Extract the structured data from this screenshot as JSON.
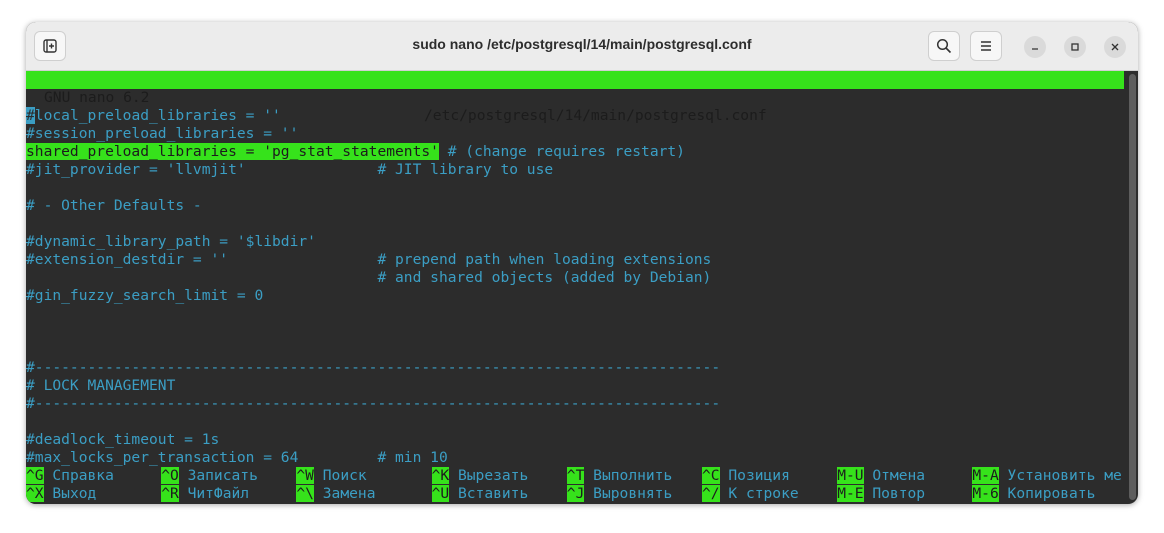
{
  "window": {
    "title": "sudo nano /etc/postgresql/14/main/postgresql.conf"
  },
  "nano": {
    "version": "GNU nano 6.2",
    "file": "/etc/postgresql/14/main/postgresql.conf"
  },
  "lines": [
    "",
    "local_preload_libraries = ''",
    "#session_preload_libraries = ''",
    "shared_preload_libraries = 'pg_stat_statements'",
    " # (change requires restart)",
    "#jit_provider = 'llvmjit'               # JIT library to use",
    "",
    "# - Other Defaults -",
    "",
    "#dynamic_library_path = '$libdir'",
    "#extension_destdir = ''                 # prepend path when loading extensions",
    "                                        # and shared objects (added by Debian)",
    "#gin_fuzzy_search_limit = 0",
    "",
    "",
    "",
    "#------------------------------------------------------------------------------",
    "# LOCK MANAGEMENT",
    "#------------------------------------------------------------------------------",
    "",
    "#deadlock_timeout = 1s",
    "#max_locks_per_transaction = 64         # min 10"
  ],
  "cursor_char": "#",
  "shortcuts_row1": [
    {
      "key": "^G",
      "label": "Справка"
    },
    {
      "key": "^O",
      "label": "Записать"
    },
    {
      "key": "^W",
      "label": "Поиск"
    },
    {
      "key": "^K",
      "label": "Вырезать"
    },
    {
      "key": "^T",
      "label": "Выполнить"
    },
    {
      "key": "^C",
      "label": "Позиция"
    },
    {
      "key": "M-U",
      "label": "Отмена"
    },
    {
      "key": "M-A",
      "label": "Установить ме"
    }
  ],
  "shortcuts_row2": [
    {
      "key": "^X",
      "label": "Выход"
    },
    {
      "key": "^R",
      "label": "ЧитФайл"
    },
    {
      "key": "^\\",
      "label": "Замена"
    },
    {
      "key": "^U",
      "label": "Вставить"
    },
    {
      "key": "^J",
      "label": "Выровнять"
    },
    {
      "key": "^/",
      "label": "К строке"
    },
    {
      "key": "M-E",
      "label": "Повтор"
    },
    {
      "key": "M-6",
      "label": "Копировать"
    }
  ]
}
